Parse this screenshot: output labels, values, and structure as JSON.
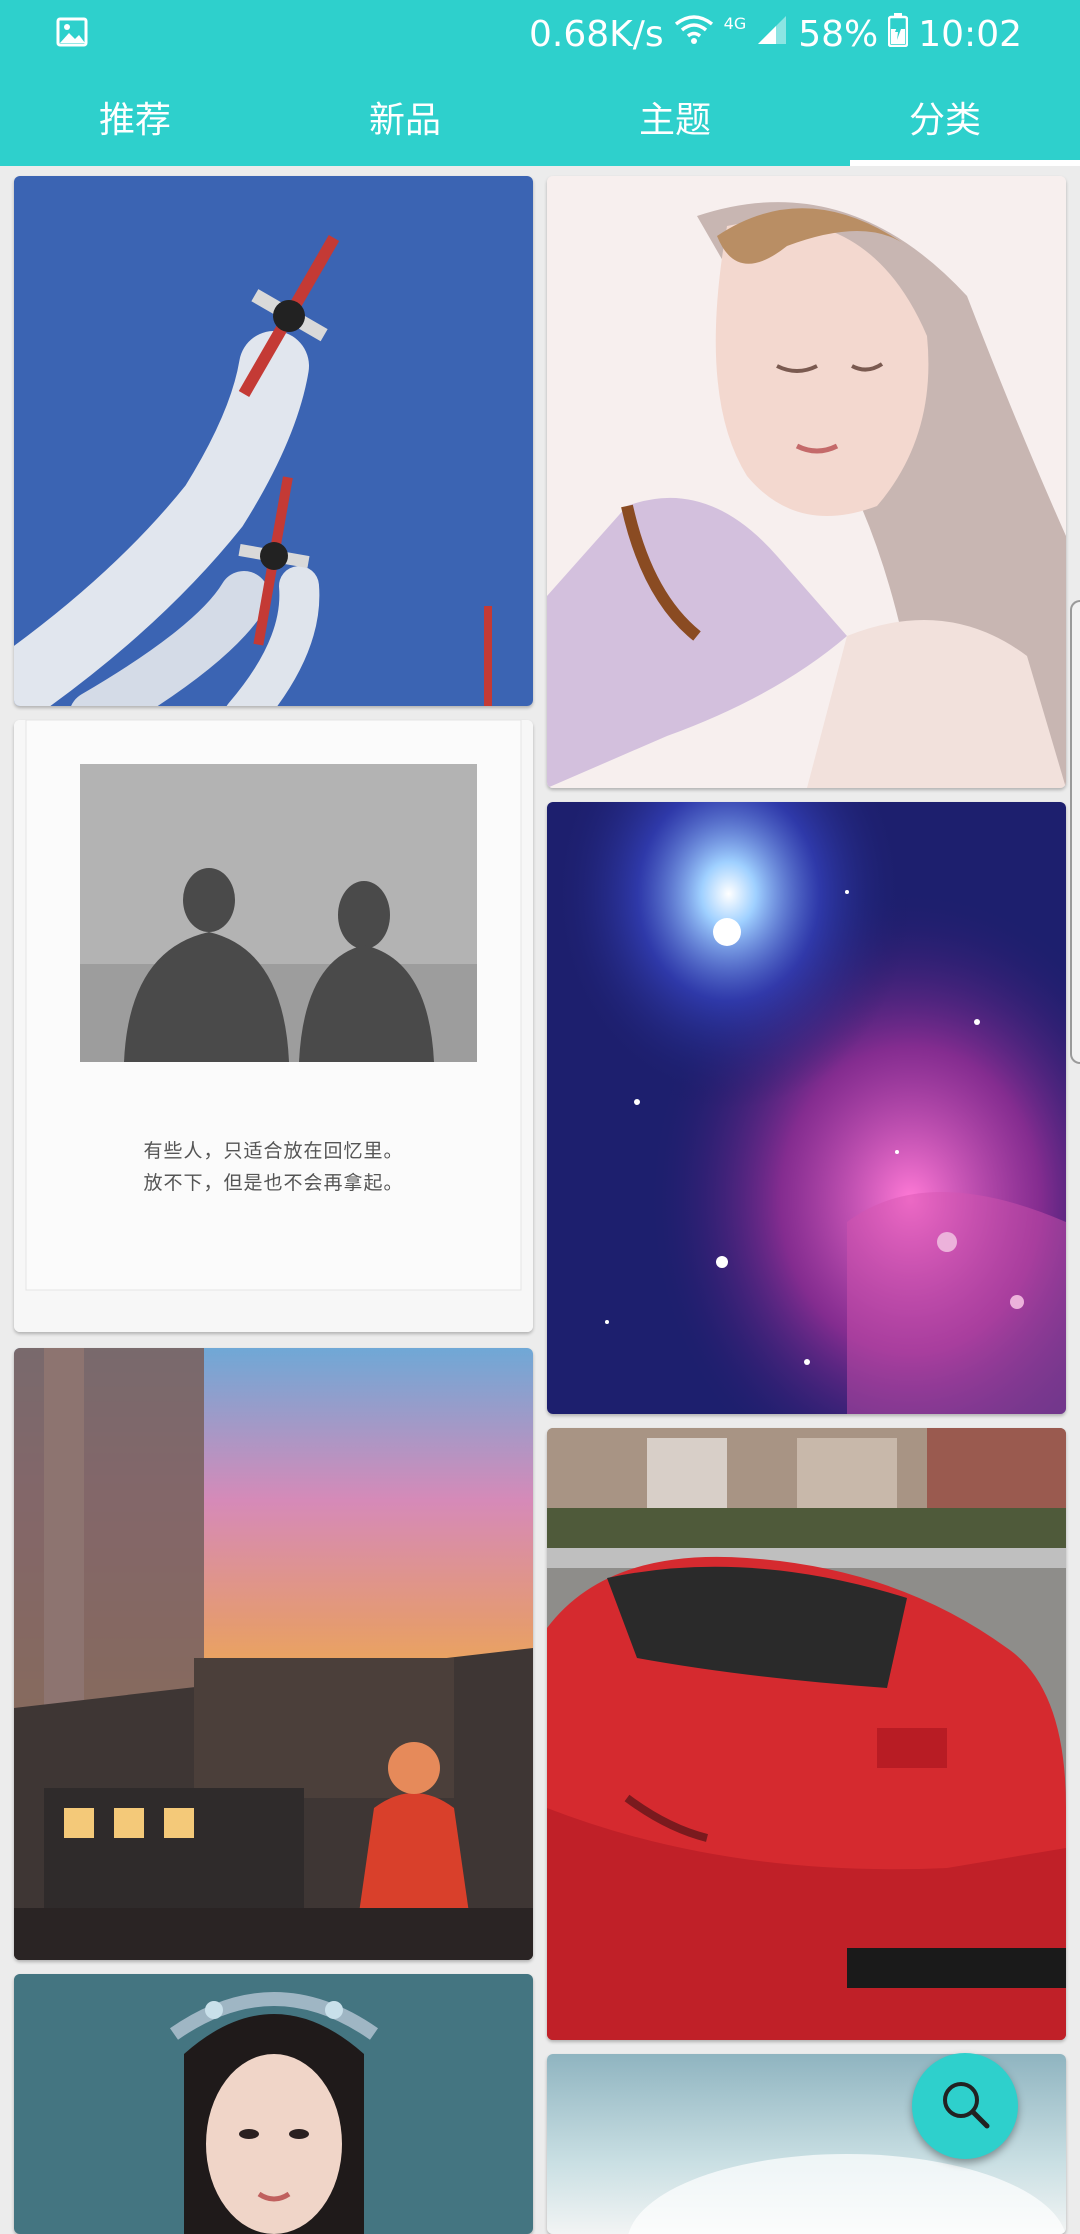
{
  "status_bar": {
    "speed": "0.68K/s",
    "network": "4G",
    "battery": "58%",
    "time": "10:02",
    "icons": [
      "image-notification-icon",
      "wifi-icon",
      "signal-icon",
      "battery-icon"
    ]
  },
  "tabs": [
    {
      "label": "推荐",
      "active": false
    },
    {
      "label": "新品",
      "active": false
    },
    {
      "label": "主题",
      "active": false
    },
    {
      "label": "分类",
      "active": true
    }
  ],
  "wallpapers": {
    "airplanes": {
      "subject": "stunt airplanes with smoke trails"
    },
    "watercolor_girl": {
      "subject": "watercolor girl illustration"
    },
    "couple_quote": {
      "subject": "black and white couple silhouette",
      "caption_line1": "有些人，只适合放在回忆里。",
      "caption_line2": "放不下，但是也不会再拿起。"
    },
    "galaxy": {
      "subject": "purple nebula starfield"
    },
    "anime_station": {
      "subject": "anime girl at train station under sunset"
    },
    "red_car": {
      "subject": "red sports car on street"
    },
    "portrait": {
      "subject": "woman in traditional headdress"
    },
    "sky": {
      "subject": "pale sky"
    }
  },
  "fab": {
    "icon": "search-icon"
  },
  "colors": {
    "accent": "#2ed0cc",
    "background": "#ececec",
    "tab_text": "#ffffff"
  }
}
